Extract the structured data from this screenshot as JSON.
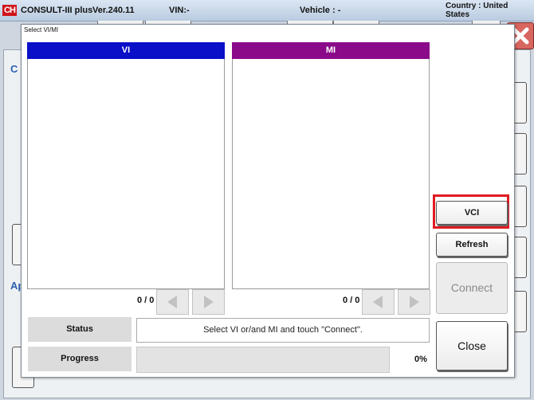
{
  "app": {
    "logo": "CH",
    "name": "CONSULT-III plus",
    "version": "Ver.240.11",
    "vin": "VIN:-",
    "vehicle": "Vehicle : -",
    "country": "Country : United States"
  },
  "background": {
    "letter_c": "C",
    "letter_a": "Ap"
  },
  "dialog": {
    "title": "Select VI/MI",
    "vi_list": {
      "header": "VI",
      "header_color": "#0a10c8",
      "count": "0 / 0",
      "items": []
    },
    "mi_list": {
      "header": "MI",
      "header_color": "#8a0a8a",
      "count": "0 / 0",
      "items": []
    },
    "buttons": {
      "vci": "VCI",
      "refresh": "Refresh",
      "connect": "Connect",
      "close": "Close"
    },
    "status_label": "Status",
    "status_text": "Select VI or/and MI and touch \"Connect\".",
    "progress_label": "Progress",
    "progress_percent": "0%",
    "progress_value": 0,
    "highlight_color": "#e01b22"
  }
}
